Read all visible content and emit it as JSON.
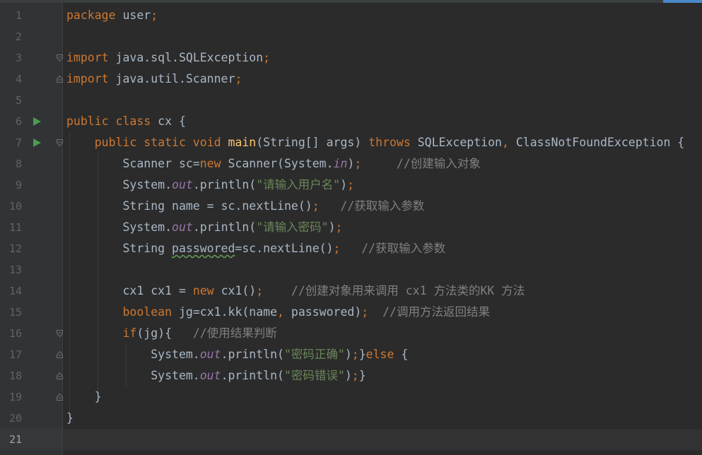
{
  "lines": [
    {
      "n": "1",
      "segments": [
        {
          "t": "package ",
          "c": "kw"
        },
        {
          "t": "user",
          "c": "df"
        },
        {
          "t": ";",
          "c": "kw"
        }
      ]
    },
    {
      "n": "2",
      "segments": []
    },
    {
      "n": "3",
      "segments": [
        {
          "t": "import ",
          "c": "kw"
        },
        {
          "t": "java.sql.SQLException",
          "c": "df"
        },
        {
          "t": ";",
          "c": "kw"
        }
      ]
    },
    {
      "n": "4",
      "segments": [
        {
          "t": "import ",
          "c": "kw"
        },
        {
          "t": "java.util.Scanner",
          "c": "df"
        },
        {
          "t": ";",
          "c": "kw"
        }
      ]
    },
    {
      "n": "5",
      "segments": []
    },
    {
      "n": "6",
      "segments": [
        {
          "t": "public class ",
          "c": "kw"
        },
        {
          "t": "cx {",
          "c": "df"
        }
      ]
    },
    {
      "n": "7",
      "segments": [
        {
          "t": "    public static void ",
          "c": "kw"
        },
        {
          "t": "main",
          "c": "fn"
        },
        {
          "t": "(String[] args) ",
          "c": "df"
        },
        {
          "t": "throws ",
          "c": "kw"
        },
        {
          "t": "SQLException",
          "c": "df"
        },
        {
          "t": ", ",
          "c": "kw"
        },
        {
          "t": "ClassNotFoundException {",
          "c": "df"
        }
      ]
    },
    {
      "n": "8",
      "segments": [
        {
          "t": "        Scanner sc=",
          "c": "df"
        },
        {
          "t": "new ",
          "c": "kw"
        },
        {
          "t": "Scanner(System.",
          "c": "df"
        },
        {
          "t": "in",
          "c": "it"
        },
        {
          "t": ")",
          "c": "df"
        },
        {
          "t": ";",
          "c": "kw"
        },
        {
          "t": "     //创建输入对象",
          "c": "cm"
        }
      ]
    },
    {
      "n": "9",
      "segments": [
        {
          "t": "        System.",
          "c": "df"
        },
        {
          "t": "out",
          "c": "it"
        },
        {
          "t": ".println(",
          "c": "df"
        },
        {
          "t": "\"请输入用户名\"",
          "c": "str"
        },
        {
          "t": ")",
          "c": "df"
        },
        {
          "t": ";",
          "c": "kw"
        }
      ]
    },
    {
      "n": "10",
      "segments": [
        {
          "t": "        String name = sc.nextLine()",
          "c": "df"
        },
        {
          "t": ";",
          "c": "kw"
        },
        {
          "t": "   //获取输入参数",
          "c": "cm"
        }
      ]
    },
    {
      "n": "11",
      "segments": [
        {
          "t": "        System.",
          "c": "df"
        },
        {
          "t": "out",
          "c": "it"
        },
        {
          "t": ".println(",
          "c": "df"
        },
        {
          "t": "\"请输入密码\"",
          "c": "str"
        },
        {
          "t": ")",
          "c": "df"
        },
        {
          "t": ";",
          "c": "kw"
        }
      ]
    },
    {
      "n": "12",
      "segments": [
        {
          "t": "        String ",
          "c": "df"
        },
        {
          "t": "passwored",
          "c": "df warn"
        },
        {
          "t": "=sc.nextLine()",
          "c": "df"
        },
        {
          "t": ";",
          "c": "kw"
        },
        {
          "t": "   //获取输入参数",
          "c": "cm"
        }
      ]
    },
    {
      "n": "13",
      "segments": []
    },
    {
      "n": "14",
      "segments": [
        {
          "t": "        cx1 cx1 = ",
          "c": "df"
        },
        {
          "t": "new ",
          "c": "kw"
        },
        {
          "t": "cx1()",
          "c": "df"
        },
        {
          "t": ";",
          "c": "kw"
        },
        {
          "t": "    //创建对象用来调用 cx1 方法类的KK 方法",
          "c": "cm"
        }
      ]
    },
    {
      "n": "15",
      "segments": [
        {
          "t": "        ",
          "c": "df"
        },
        {
          "t": "boolean ",
          "c": "kw"
        },
        {
          "t": "jg=cx1.kk(name",
          "c": "df"
        },
        {
          "t": ", ",
          "c": "kw"
        },
        {
          "t": "passwored)",
          "c": "df"
        },
        {
          "t": ";",
          "c": "kw"
        },
        {
          "t": "  //调用方法返回结果",
          "c": "cm"
        }
      ]
    },
    {
      "n": "16",
      "segments": [
        {
          "t": "        ",
          "c": "df"
        },
        {
          "t": "if",
          "c": "kw"
        },
        {
          "t": "(jg){",
          "c": "df"
        },
        {
          "t": "   //使用结果判断",
          "c": "cm"
        }
      ]
    },
    {
      "n": "17",
      "segments": [
        {
          "t": "            System.",
          "c": "df"
        },
        {
          "t": "out",
          "c": "it"
        },
        {
          "t": ".println(",
          "c": "df"
        },
        {
          "t": "\"密码正确\"",
          "c": "str"
        },
        {
          "t": ")",
          "c": "df"
        },
        {
          "t": ";",
          "c": "kw"
        },
        {
          "t": "}",
          "c": "df"
        },
        {
          "t": "else ",
          "c": "kw"
        },
        {
          "t": "{",
          "c": "df"
        }
      ]
    },
    {
      "n": "18",
      "segments": [
        {
          "t": "            System.",
          "c": "df"
        },
        {
          "t": "out",
          "c": "it"
        },
        {
          "t": ".println(",
          "c": "df"
        },
        {
          "t": "\"密码错误\"",
          "c": "str"
        },
        {
          "t": ")",
          "c": "df"
        },
        {
          "t": ";",
          "c": "kw"
        },
        {
          "t": "}",
          "c": "df"
        }
      ]
    },
    {
      "n": "19",
      "segments": [
        {
          "t": "    }",
          "c": "df"
        }
      ]
    },
    {
      "n": "20",
      "segments": [
        {
          "t": "}",
          "c": "df"
        }
      ]
    },
    {
      "n": "21",
      "segments": []
    }
  ],
  "run_markers": [
    "6",
    "7"
  ],
  "fold_markers": {
    "3": "open",
    "4": "close",
    "7": "open",
    "16": "open",
    "17": "mid",
    "18": "mid",
    "19": "close"
  },
  "caret_line": "21",
  "icons": {
    "run": "run-arrow-icon",
    "fold": "fold-marker-icon"
  },
  "colors": {
    "background": "#2b2b2b",
    "keyword": "#cc7832",
    "function": "#ffc66d",
    "string": "#6a8759",
    "comment": "#808080",
    "static_field": "#9876aa",
    "default": "#a9b7c6",
    "run_marker": "#499c54"
  }
}
